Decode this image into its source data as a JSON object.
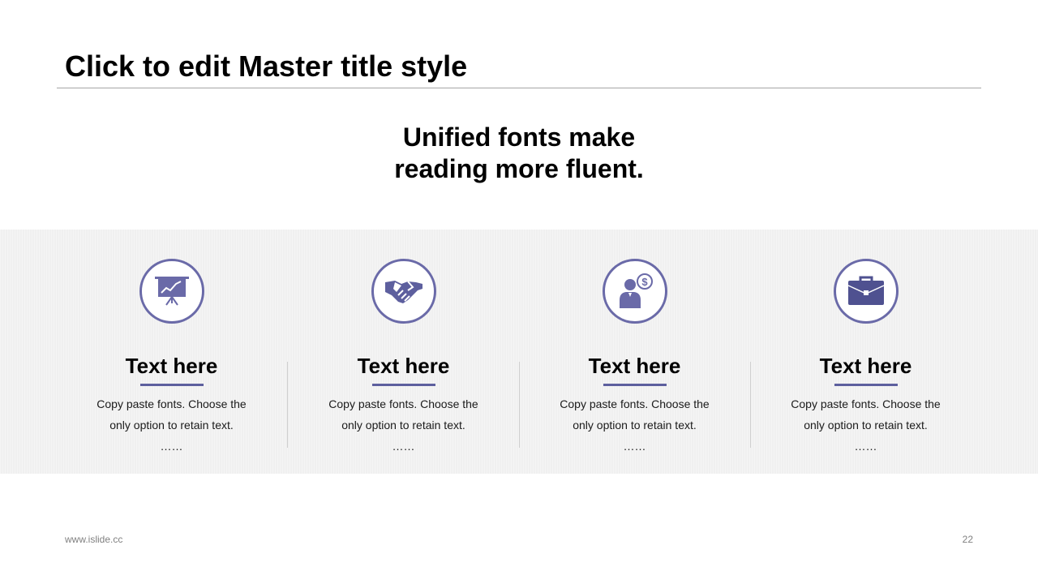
{
  "slide": {
    "title": "Click to edit Master title style",
    "subtitle_line1": "Unified fonts make",
    "subtitle_line2": "reading more fluent."
  },
  "cards": [
    {
      "icon": "presentation-chart-icon",
      "title": "Text here",
      "body_line1": "Copy paste fonts. Choose the",
      "body_line2": "only option to retain text.",
      "ellipsis": "……"
    },
    {
      "icon": "handshake-icon",
      "title": "Text here",
      "body_line1": "Copy paste fonts. Choose the",
      "body_line2": "only option to retain text.",
      "ellipsis": "……"
    },
    {
      "icon": "businessman-dollar-icon",
      "title": "Text here",
      "body_line1": "Copy paste fonts. Choose the",
      "body_line2": "only option to retain text.",
      "ellipsis": "……"
    },
    {
      "icon": "briefcase-icon",
      "title": "Text here",
      "body_line1": "Copy paste fonts. Choose the",
      "body_line2": "only option to retain text.",
      "ellipsis": "……"
    }
  ],
  "footer": {
    "website": "www.islide.cc",
    "page_number": "22"
  },
  "colors": {
    "accent": "#5d5f9e",
    "icon_ring": "#6a6aa8",
    "band_background": "#f0f0f0",
    "rule": "#a6a6a6"
  }
}
